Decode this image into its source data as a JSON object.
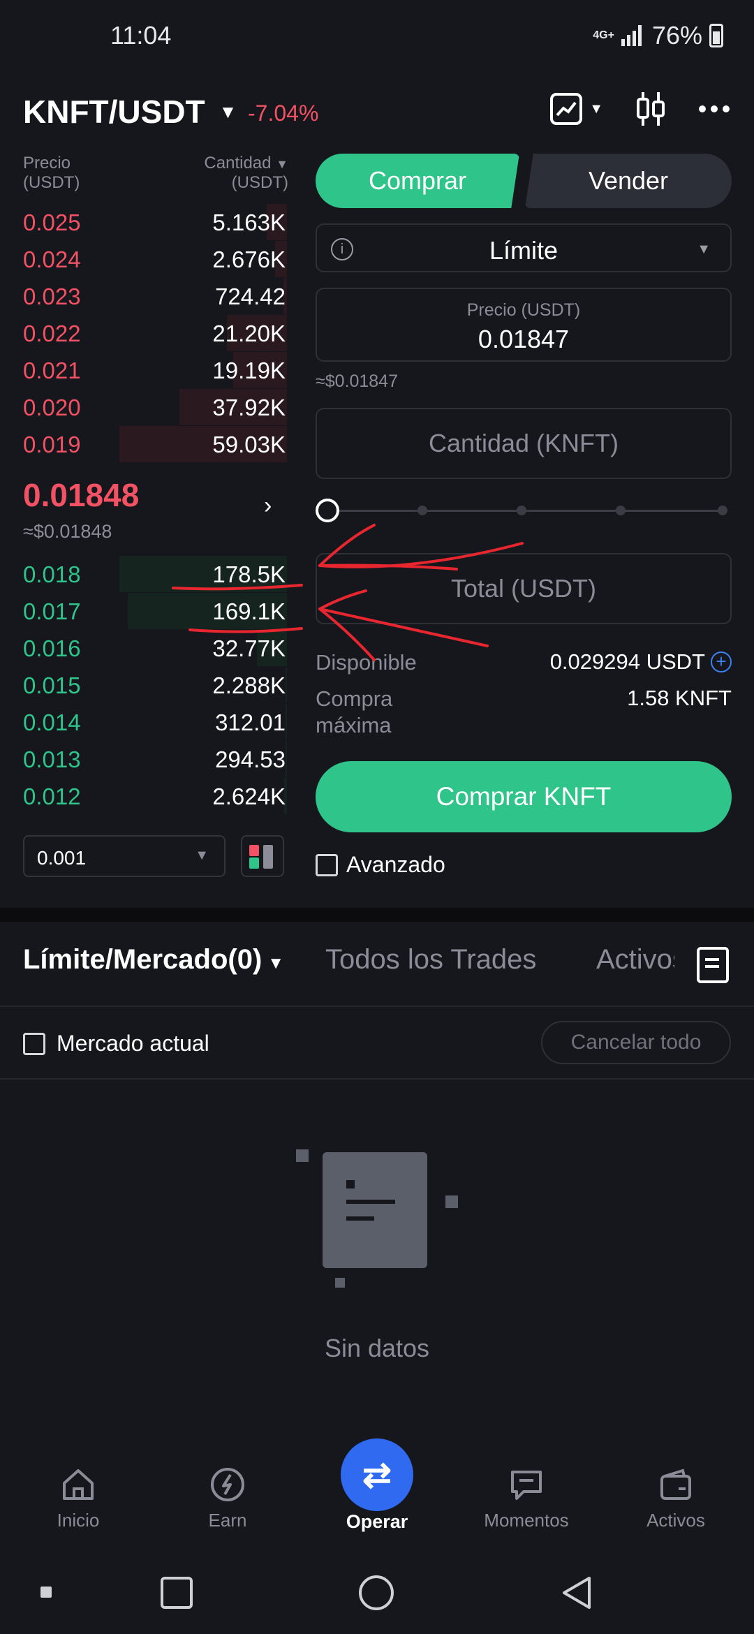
{
  "status_bar": {
    "time": "11:04",
    "network": "4G+",
    "battery": "76%"
  },
  "header": {
    "pair": "KNFT/USDT",
    "change": "-7.04%"
  },
  "order_book": {
    "price_header": "Precio",
    "price_unit": "(USDT)",
    "qty_header": "Cantidad",
    "qty_unit": "(USDT)",
    "asks": [
      {
        "price": "0.025",
        "qty": "5.163K"
      },
      {
        "price": "0.024",
        "qty": "2.676K"
      },
      {
        "price": "0.023",
        "qty": "724.42"
      },
      {
        "price": "0.022",
        "qty": "21.20K"
      },
      {
        "price": "0.021",
        "qty": "19.19K"
      },
      {
        "price": "0.020",
        "qty": "37.92K"
      },
      {
        "price": "0.019",
        "qty": "59.03K"
      }
    ],
    "last_price": "0.01848",
    "last_price_usd": "≈$0.01848",
    "bids": [
      {
        "price": "0.018",
        "qty": "178.5K"
      },
      {
        "price": "0.017",
        "qty": "169.1K"
      },
      {
        "price": "0.016",
        "qty": "32.77K"
      },
      {
        "price": "0.015",
        "qty": "2.288K"
      },
      {
        "price": "0.014",
        "qty": "312.01"
      },
      {
        "price": "0.013",
        "qty": "294.53"
      },
      {
        "price": "0.012",
        "qty": "2.624K"
      }
    ],
    "step": "0.001"
  },
  "trade": {
    "buy_tab": "Comprar",
    "sell_tab": "Vender",
    "order_type": "Límite",
    "price_label": "Precio (USDT)",
    "price_value": "0.01847",
    "price_usd": "≈$0.01847",
    "qty_placeholder": "Cantidad (KNFT)",
    "total_placeholder": "Total (USDT)",
    "available_label": "Disponible",
    "available_value": "0.029294 USDT",
    "max_buy_label_1": "Compra",
    "max_buy_label_2": "máxima",
    "max_buy_value": "1.58 KNFT",
    "buy_button": "Comprar KNFT",
    "advanced": "Avanzado"
  },
  "orders": {
    "tab_open": "Límite/Mercado(0)",
    "tab_trades": "Todos los Trades",
    "tab_assets": "Activos",
    "current_market": "Mercado actual",
    "cancel_all": "Cancelar todo",
    "empty": "Sin datos"
  },
  "nav": {
    "home": "Inicio",
    "earn": "Earn",
    "trade": "Operar",
    "moments": "Momentos",
    "assets": "Activos"
  },
  "colors": {
    "ask": "#f25263",
    "bid": "#2ec48a",
    "accent": "#2f6af0"
  },
  "depth": {
    "asks": [
      0.12,
      0.07,
      0.02,
      0.36,
      0.32,
      0.64,
      1.0
    ],
    "bids": [
      1.0,
      0.95,
      0.18,
      0.01,
      0.002,
      0.002,
      0.015
    ]
  }
}
